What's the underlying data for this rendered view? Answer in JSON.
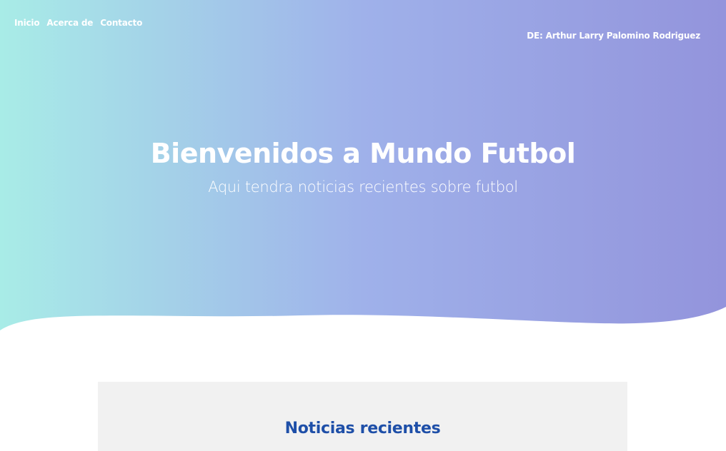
{
  "nav": {
    "items": [
      {
        "label": "Inicio"
      },
      {
        "label": "Acerca de"
      },
      {
        "label": "Contacto"
      }
    ]
  },
  "header": {
    "author": "DE: Arthur Larry Palomino Rodriguez"
  },
  "hero": {
    "title": "Bienvenidos a Mundo Futbol",
    "subtitle": "Aqui tendra noticias recientes sobre futbol",
    "gradient_start": "#a8ece7",
    "gradient_mid": "#9fb1ea",
    "gradient_end": "#9394dc"
  },
  "news": {
    "title": "Noticias recientes",
    "title_color": "#1e4fa8",
    "background": "#f1f1f1"
  }
}
